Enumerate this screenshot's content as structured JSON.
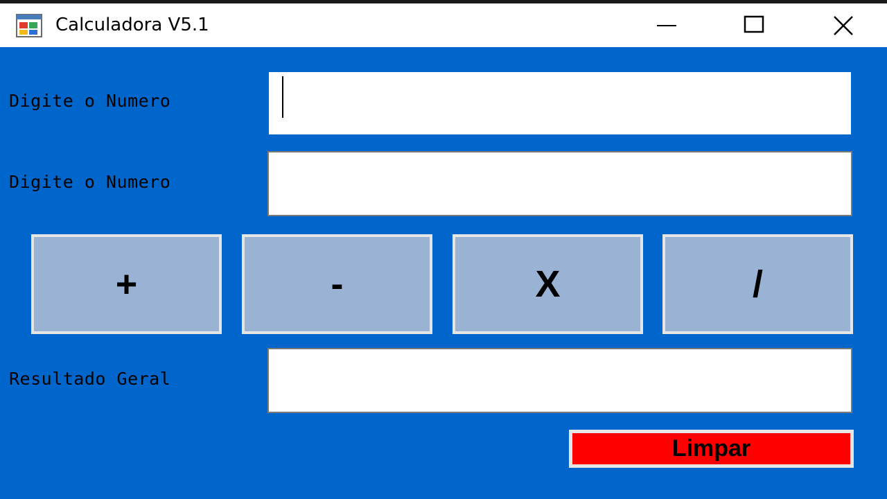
{
  "window": {
    "title": "Calculadora V5.1",
    "icon": "windows-form-icon",
    "controls": {
      "minimize_icon": "minimize-icon",
      "maximize_icon": "maximize-icon",
      "close_icon": "close-icon"
    },
    "background_color": "#0066cc"
  },
  "form": {
    "first_number": {
      "label": "Digite o Numero",
      "value": "",
      "focused": true
    },
    "second_number": {
      "label": "Digite o Numero",
      "value": ""
    },
    "operations": [
      {
        "label": "+",
        "name": "add"
      },
      {
        "label": "-",
        "name": "subtract"
      },
      {
        "label": "X",
        "name": "multiply"
      },
      {
        "label": "/",
        "name": "divide"
      }
    ],
    "operation_button_color": "#9ab3d4",
    "result": {
      "label": "Resultado Geral",
      "value": ""
    },
    "clear_button": {
      "label": "Limpar",
      "color": "#ff0000"
    }
  }
}
